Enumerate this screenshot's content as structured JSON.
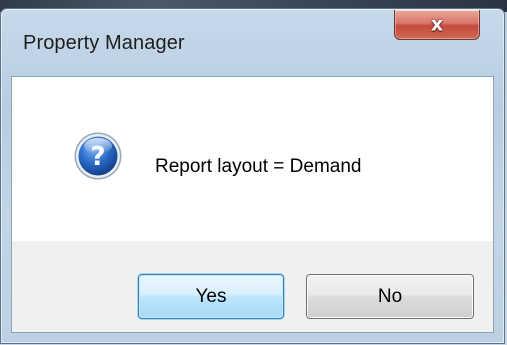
{
  "window": {
    "title": "Property Manager",
    "close_label": "x"
  },
  "message": {
    "icon": "question-icon",
    "text": "Report layout = Demand"
  },
  "buttons": {
    "yes_label": "Yes",
    "no_label": "No"
  },
  "colors": {
    "close_button": "#c44a3c",
    "default_button_border": "#3c7fb1",
    "icon_blue": "#1f5fb8"
  }
}
